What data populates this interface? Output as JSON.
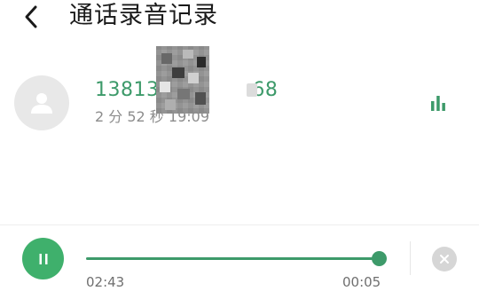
{
  "header": {
    "back_icon": "chevron-left-icon",
    "title": "通话录音记录"
  },
  "record": {
    "avatar_icon": "person-icon",
    "phone_prefix": "13813",
    "phone_suffix": "68",
    "duration": "2 分 52 秒",
    "time": "19:09",
    "sim_icon": "sim-card-icon",
    "playing_icon": "audio-bars-icon",
    "accent_color": "#3d9a6a"
  },
  "player": {
    "pause_icon": "pause-icon",
    "current_time": "02:43",
    "total_time": "00:05",
    "progress": 1.0,
    "close_icon": "close-icon",
    "button_color": "#3fb06c"
  }
}
